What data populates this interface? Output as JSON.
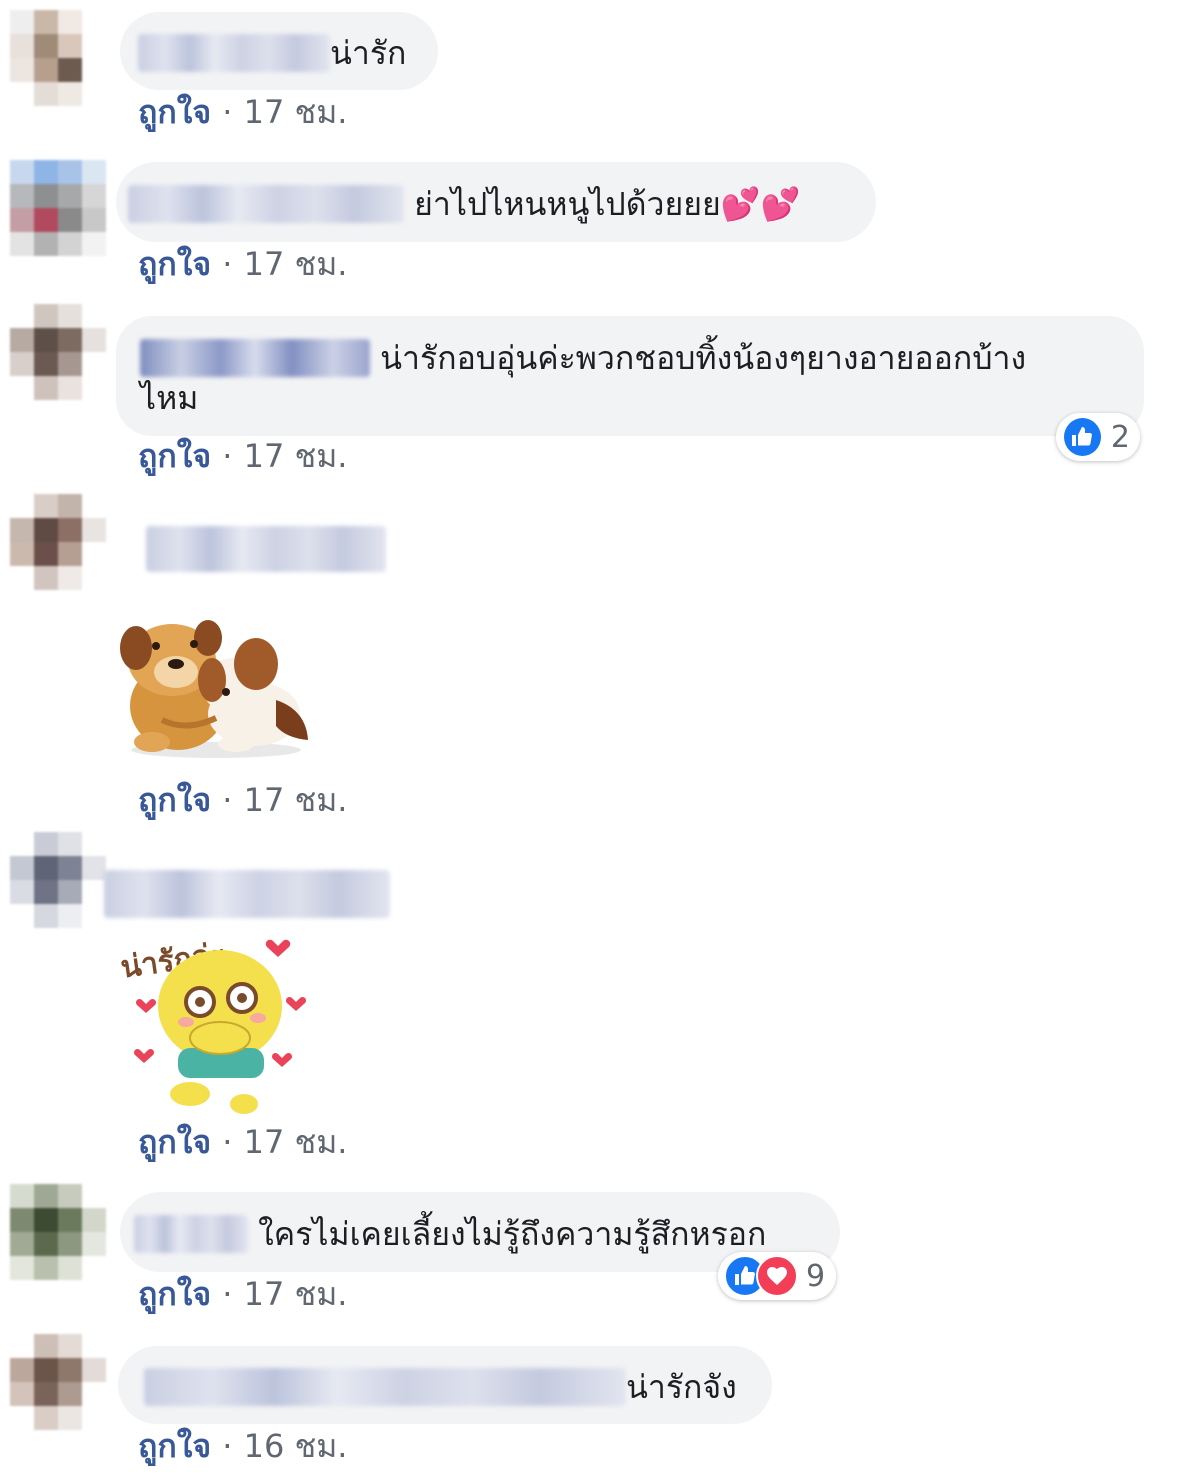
{
  "comments": [
    {
      "text": "น่ารัก",
      "like": "ถูกใจ",
      "sep": "·",
      "time": "17 ชม."
    },
    {
      "text": "ย่าไปไหนหนูไปด้วยยย",
      "emoji": "💕💕",
      "like": "ถูกใจ",
      "sep": "·",
      "time": "17 ชม."
    },
    {
      "text": "น่ารักอบอุ่นค่ะพวกชอบทิ้งน้องๆยางอายออกบ้าง",
      "text2": "ไหม",
      "like": "ถูกใจ",
      "sep": "·",
      "time": "17 ชม.",
      "reaction_count": "2"
    },
    {
      "sticker": "puppies-hug-sticker",
      "like": "ถูกใจ",
      "sep": "·",
      "time": "17 ชม."
    },
    {
      "sticker": "yellow-character-sticker",
      "sticker_caption": "น่ารักอ่ะ",
      "like": "ถูกใจ",
      "sep": "·",
      "time": "17 ชม."
    },
    {
      "text": "ใครไม่เคยเลี้ยงไม่รู้ถึงความรู้สึกหรอก",
      "like": "ถูกใจ",
      "sep": "·",
      "time": "17 ชม.",
      "reaction_count": "9"
    },
    {
      "text": "น่ารักจัง",
      "like": "ถูกใจ",
      "sep": "·",
      "time": "16 ชม."
    }
  ],
  "colors": {
    "bubble": "#f2f3f5",
    "link": "#385898",
    "meta": "#606770",
    "like_reaction": "#1877f2",
    "love_reaction": "#f33e58"
  },
  "icons": [
    "like-reaction-icon",
    "love-reaction-icon"
  ]
}
